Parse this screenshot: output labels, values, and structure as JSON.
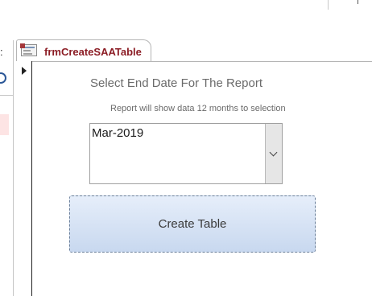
{
  "tab": {
    "title": "frmCreateSAATable"
  },
  "form": {
    "heading": "Select End Date For The Report",
    "subheading": "Report will show data 12 months to selection",
    "date_field": {
      "value": "Mar-2019"
    },
    "create_button_label": "Create Table"
  },
  "nav": {
    "colon_glyph": ":"
  },
  "colors": {
    "tab_title": "#8b1c24",
    "button_gradient_top": "#e6eefa",
    "button_gradient_bottom": "#c8d8ef"
  },
  "icons": {
    "form_icon": "form-icon",
    "dropdown_icon": "chevron-down-icon",
    "record_selector_icon": "record-pointer-icon",
    "search_icon": "search-icon"
  }
}
